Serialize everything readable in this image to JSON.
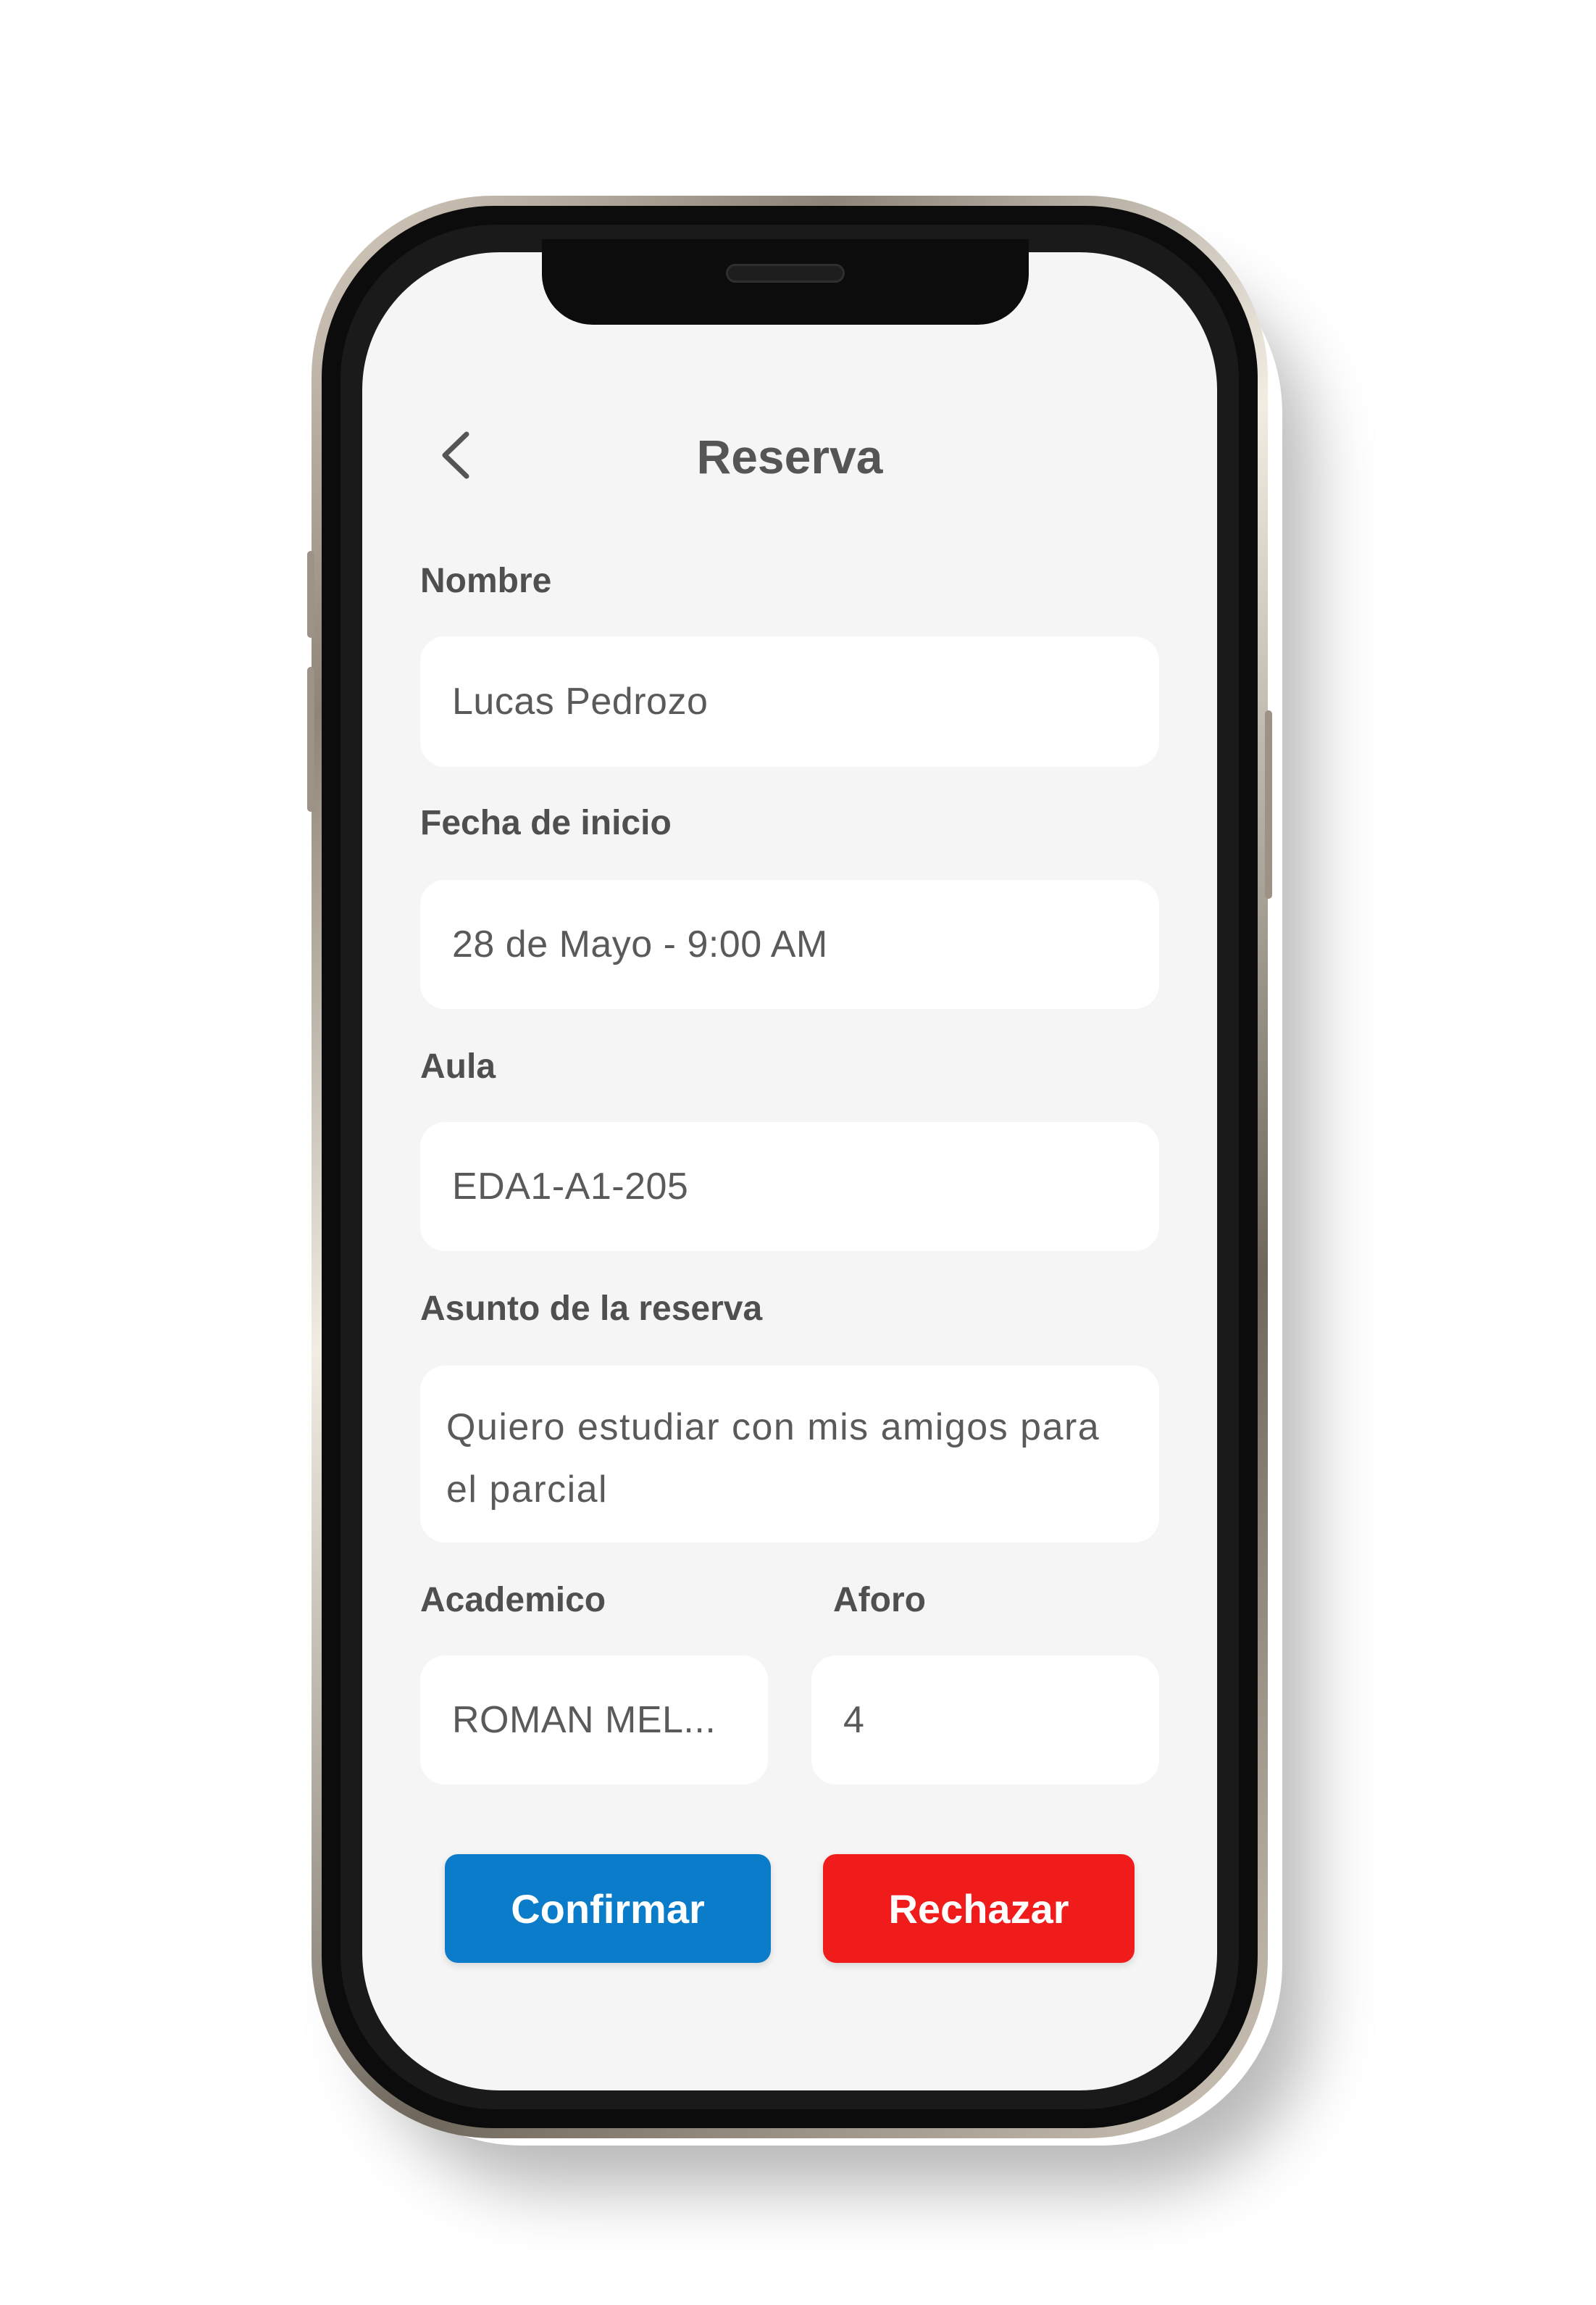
{
  "header": {
    "title": "Reserva"
  },
  "form": {
    "nombre": {
      "label": "Nombre",
      "value": "Lucas Pedrozo"
    },
    "fecha_inicio": {
      "label": "Fecha de inicio",
      "value": "28 de Mayo - 9:00 AM"
    },
    "aula": {
      "label": "Aula",
      "value": "EDA1-A1-205"
    },
    "asunto": {
      "label": "Asunto de la reserva",
      "value": "Quiero estudiar con mis amigos para el parcial"
    },
    "academico": {
      "label": "Academico",
      "value": "ROMAN MEL..."
    },
    "aforo": {
      "label": "Aforo",
      "value": "4"
    }
  },
  "actions": {
    "confirm_label": "Confirmar",
    "reject_label": "Rechazar"
  },
  "icons": {
    "back": "chevron-left-icon"
  },
  "colors": {
    "confirm": "#0a7cc9",
    "reject": "#f01c1c",
    "screen_background": "#f5f5f6",
    "field_background": "#ffffff"
  }
}
